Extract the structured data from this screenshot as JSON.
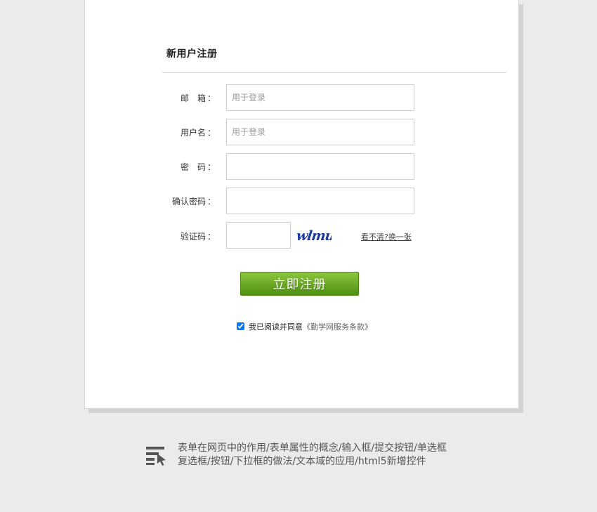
{
  "form": {
    "title": "新用户注册",
    "email": {
      "label": "邮　箱",
      "placeholder": "用于登录",
      "value": ""
    },
    "username": {
      "label": "用户名",
      "placeholder": "用于登录",
      "value": ""
    },
    "password": {
      "label": "密　码",
      "placeholder": "",
      "value": ""
    },
    "confirm_password": {
      "label": "确认密码",
      "placeholder": "",
      "value": ""
    },
    "captcha": {
      "label": "验证码",
      "value": "",
      "image_text": "wlmu",
      "refresh_label": "看不清?换一张"
    },
    "colon": "：",
    "submit_label": "立即注册",
    "agreement": {
      "checked": true,
      "text": "我已阅读并同意",
      "terms": "《勤学网服务条款》"
    }
  },
  "footer": {
    "line1": "表单在网页中的作用/表单属性的概念/输入框/提交按钮/单选框",
    "line2": "复选框/按钮/下拉框的做法/文本域的应用/html5新增控件",
    "icon": "form-cursor-icon"
  },
  "colors": {
    "background": "#ebebeb",
    "card": "#ffffff",
    "accent_green": "#6aa823",
    "captcha_blue": "#1a3a9c"
  }
}
